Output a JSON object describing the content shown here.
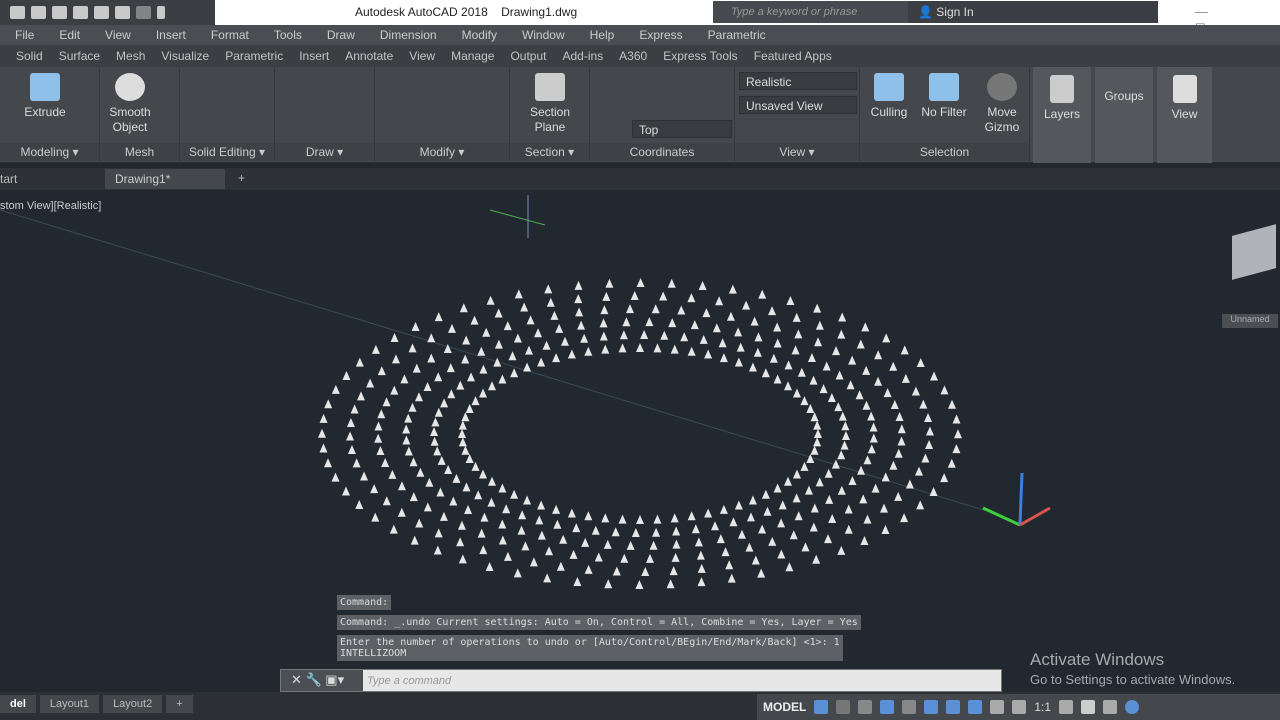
{
  "app": {
    "title": "Autodesk AutoCAD 2018    Drawing1.dwg",
    "search_placeholder": "Type a keyword or phrase",
    "sign_in": "Sign In",
    "window_controls": "— ◻"
  },
  "menu": [
    "File",
    "Edit",
    "View",
    "Insert",
    "Format",
    "Tools",
    "Draw",
    "Dimension",
    "Modify",
    "Window",
    "Help",
    "Express",
    "Parametric"
  ],
  "ribbon_tabs": [
    "Solid",
    "Surface",
    "Mesh",
    "Visualize",
    "Parametric",
    "Insert",
    "Annotate",
    "View",
    "Manage",
    "Output",
    "Add-ins",
    "A360",
    "Express Tools",
    "Featured Apps"
  ],
  "ribbon": {
    "extrude": "Extrude",
    "smooth_object": "Smooth Object",
    "section_plane": "Section Plane",
    "visual_style": "Realistic",
    "named_view": "Unsaved View",
    "ucs_view": "Top",
    "culling": "Culling",
    "no_filter": "No Filter",
    "move_gizmo": "Move Gizmo",
    "layers": "Layers",
    "groups": "Groups",
    "view": "View",
    "panels": [
      "Modeling ▾",
      "Mesh",
      "Solid Editing ▾",
      "Draw ▾",
      "Modify ▾",
      "Section ▾",
      "Coordinates",
      "View ▾",
      "Selection"
    ]
  },
  "doc_tabs": {
    "start": "tart",
    "drawing": "Drawing1*",
    "plus": "+"
  },
  "viewport": {
    "label": "stom View][Realistic]",
    "viewcube_label": "Unnamed"
  },
  "command": {
    "history": [
      "Command:",
      "Command: _.undo Current settings: Auto = On, Control = All, Combine = Yes, Layer = Yes",
      "Enter the number of operations to undo or [Auto/Control/BEgin/End/Mark/Back] <1>: 1\nINTELLIZOOM"
    ],
    "placeholder": "Type a command",
    "buttons": "✕ 🔧 ▣▾"
  },
  "watermark": {
    "line1": "Activate Windows",
    "line2": "Go to Settings to activate Windows."
  },
  "layout_tabs": [
    "del",
    "Layout1",
    "Layout2",
    "+"
  ],
  "status": {
    "model": "MODEL",
    "scale": "1:1"
  },
  "colors": {
    "viewport_bg": "#212830",
    "ribbon_bg": "#44474b",
    "accent": "#5b8fd6"
  }
}
